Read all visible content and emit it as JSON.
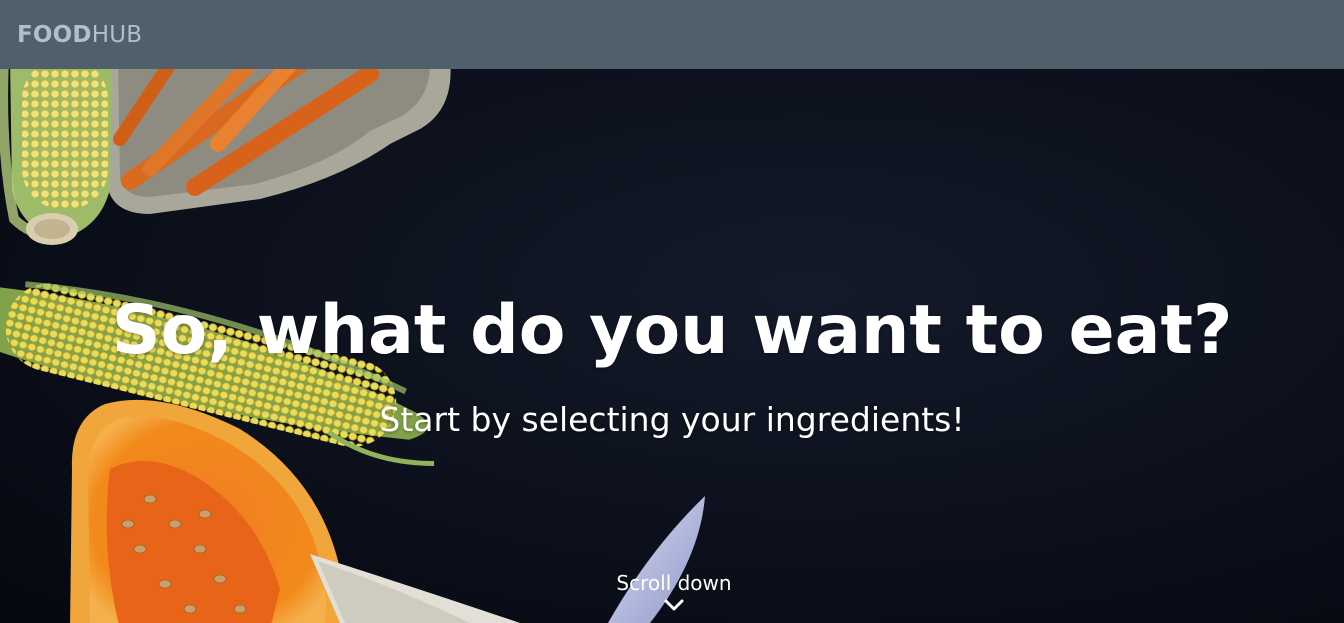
{
  "navbar": {
    "brand_bold": "FOOD",
    "brand_light": "HUB"
  },
  "hero": {
    "headline": "So, what do you want to eat?",
    "subheadline": "Start by selecting your ingredients!",
    "scroll_label": "Scroll down",
    "scroll_icon": "chevron-down-icon",
    "background_image": "photo of vegetables: corn, carrots, pumpkin, knife on dark cloth"
  },
  "colors": {
    "navbar_bg": "#4f5f6c",
    "brand_text": "#aebfcd",
    "hero_text": "#ffffff",
    "hero_bg": "#0d1220"
  }
}
